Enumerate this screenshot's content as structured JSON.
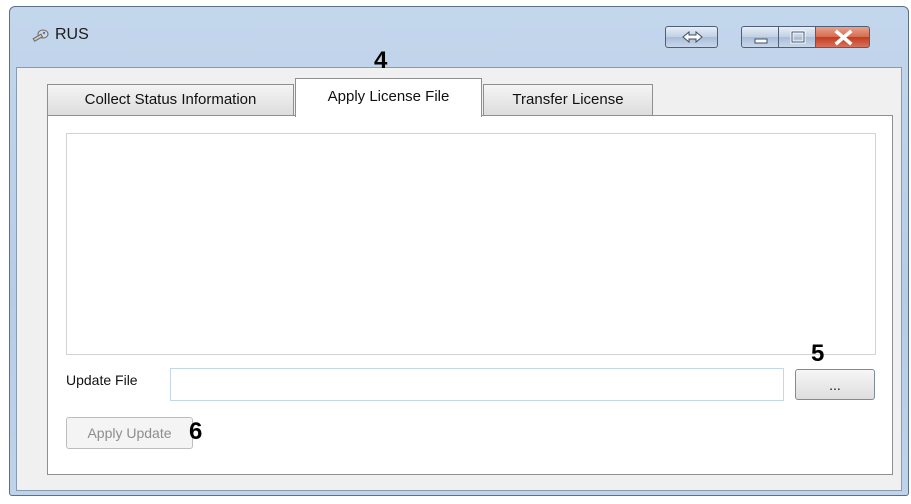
{
  "window": {
    "title": "RUS"
  },
  "tabs": [
    {
      "label": "Collect Status Information"
    },
    {
      "label": "Apply License File"
    },
    {
      "label": "Transfer License"
    }
  ],
  "form": {
    "update_file_label": "Update File",
    "update_file_value": "",
    "browse_label": "...",
    "apply_update_label": "Apply Update"
  },
  "callouts": [
    "4",
    "5",
    "6"
  ],
  "colors": {
    "close_button": "#c84a2c",
    "window_frame": "#b9cfe8"
  }
}
